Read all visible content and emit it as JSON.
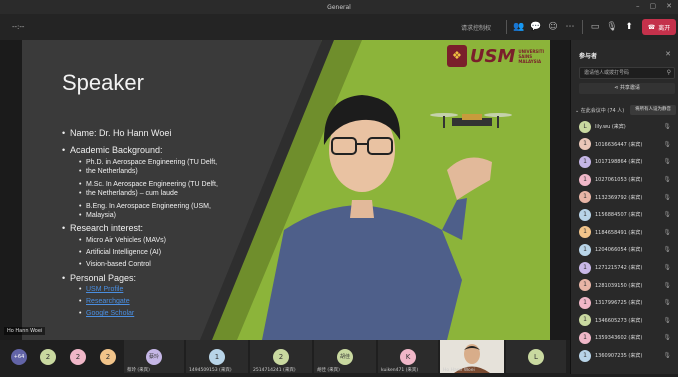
{
  "window": {
    "title": "General"
  },
  "toolbar": {
    "timer": "--:--",
    "text_button": "请求控制权",
    "leave_label": "离开",
    "icons": [
      "people-icon",
      "chat-icon",
      "reactions-icon",
      "more-icon",
      "camera-icon",
      "mic-icon",
      "share-icon"
    ]
  },
  "slide": {
    "title": "Speaker",
    "name_line": "Name: Dr. Ho Hann Woei",
    "academic_heading": "Academic Background:",
    "phd": "Ph.D. in Aerospace Engineering (TU Delft,",
    "phd2": "the Netherlands)",
    "msc": "M.Sc. In Aerospace Engineering (TU Delft,",
    "msc2": "the Netherlands) – cum laude",
    "beng": "B.Eng. In Aerospace Engineering (USM,",
    "beng2": "Malaysia)",
    "research_heading": "Research interest:",
    "r1": "Micro Air Vehicles (MAVs)",
    "r2": "Artificial Intelligence (AI)",
    "r3": "Vision-based Control",
    "personal_heading": "Personal Pages:",
    "l1": "USM Profile",
    "l2": "Researchgate",
    "l3": "Google Scholar",
    "logo_word": "USM",
    "logo_sub1": "UNIVERSITI",
    "logo_sub2": "SAINS",
    "logo_sub3": "MALAYSIA",
    "speaker_label": "Ho Hann Woei",
    "colors": {
      "green": "#8cb43a",
      "dark": "#3a3a3a"
    }
  },
  "panel": {
    "title": "参与者",
    "search_placeholder": "邀请他人或拨打号码",
    "share_label": "共享邀请",
    "section_label": "在此会议中 (74 人)",
    "mute_all_label": "将所有人设为静音",
    "participants": [
      {
        "name": "lily.wu (来宾)",
        "color": "#c9d9a0",
        "initial": "L"
      },
      {
        "name": "1016636447 (来宾)",
        "color": "#e9c7b8",
        "initial": "1"
      },
      {
        "name": "1017198864 (来宾)",
        "color": "#c5b6e6",
        "initial": "1"
      },
      {
        "name": "1027061053 (来宾)",
        "color": "#f0b7c8",
        "initial": "1"
      },
      {
        "name": "1132369792 (来宾)",
        "color": "#e8b5a6",
        "initial": "1"
      },
      {
        "name": "1156884507 (来宾)",
        "color": "#b8d4e8",
        "initial": "1"
      },
      {
        "name": "1184658491 (来宾)",
        "color": "#f2c48a",
        "initial": "1"
      },
      {
        "name": "1204066054 (来宾)",
        "color": "#b8d4e8",
        "initial": "1"
      },
      {
        "name": "1271215742 (来宾)",
        "color": "#c9b8e8",
        "initial": "1"
      },
      {
        "name": "1281039150 (来宾)",
        "color": "#e8b5a6",
        "initial": "1"
      },
      {
        "name": "1317996725 (来宾)",
        "color": "#f0b7c8",
        "initial": "1"
      },
      {
        "name": "1346605273 (来宾)",
        "color": "#c9d9a0",
        "initial": "1"
      },
      {
        "name": "1359343602 (来宾)",
        "color": "#f0b7c8",
        "initial": "1"
      },
      {
        "name": "1360907235 (来宾)",
        "color": "#b8d4e8",
        "initial": "1"
      }
    ]
  },
  "bottom": {
    "overflow": "+64",
    "tiles": [
      {
        "initial": "2",
        "color": "#c9d9a0",
        "name": ""
      },
      {
        "initial": "2",
        "color": "#f0b7c8",
        "name": ""
      },
      {
        "initial": "2",
        "color": "#f2c48a",
        "name": ""
      },
      {
        "initial": "蔡玲",
        "color": "#c5b6e6",
        "name": "蔡玲 (来宾)"
      },
      {
        "initial": "1",
        "color": "#b8d4e8",
        "name": "1494509153 (来宾)"
      },
      {
        "initial": "2",
        "color": "#c9d9a0",
        "name": "2514714241 (来宾)"
      },
      {
        "initial": "胡佳",
        "color": "#c9d9a0",
        "name": "胡佳 (来宾)"
      },
      {
        "initial": "K",
        "color": "#f0b7c8",
        "name": "kuiken471 (来宾)"
      },
      {
        "initial": "",
        "color": "#e8e0d0",
        "name": "Ho Hann Woei"
      },
      {
        "initial": "L",
        "color": "#c9d9a0",
        "name": ""
      }
    ]
  }
}
